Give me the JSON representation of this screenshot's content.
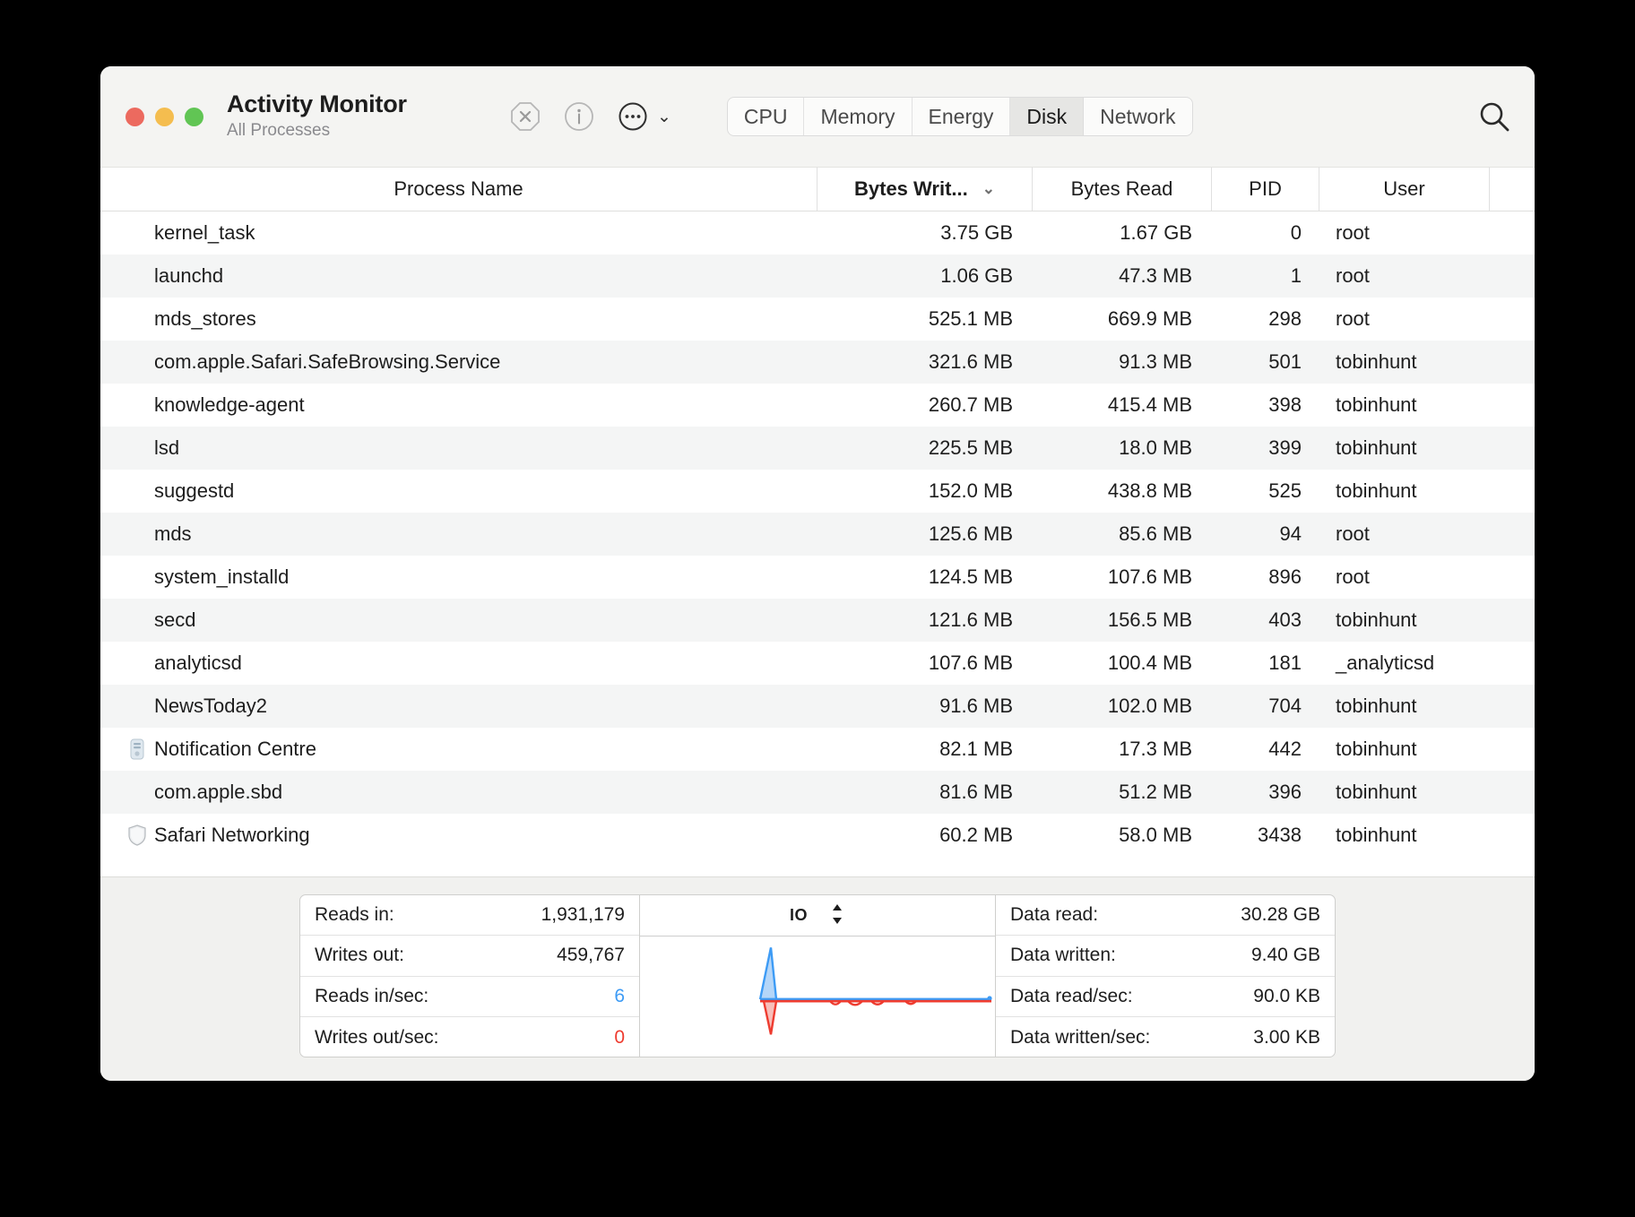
{
  "window": {
    "app_title": "Activity Monitor",
    "subtitle": "All Processes"
  },
  "toolbar": {
    "quit_icon": "stop-process-icon",
    "info_icon": "info-icon",
    "more_icon": "more-options-icon",
    "chevron": "⌄",
    "search_icon": "search-icon",
    "tabs": [
      {
        "label": "CPU",
        "active": false
      },
      {
        "label": "Memory",
        "active": false
      },
      {
        "label": "Energy",
        "active": false
      },
      {
        "label": "Disk",
        "active": true
      },
      {
        "label": "Network",
        "active": false
      }
    ]
  },
  "table": {
    "columns": [
      {
        "key": "name",
        "label": "Process Name"
      },
      {
        "key": "bytes_written",
        "label": "Bytes Writ...",
        "sorted": true,
        "sort_chevron": "⌄"
      },
      {
        "key": "bytes_read",
        "label": "Bytes Read"
      },
      {
        "key": "pid",
        "label": "PID"
      },
      {
        "key": "user",
        "label": "User"
      }
    ],
    "rows": [
      {
        "name": "kernel_task",
        "bytes_written": "3.75 GB",
        "bytes_read": "1.67 GB",
        "pid": "0",
        "user": "root",
        "icon": null
      },
      {
        "name": "launchd",
        "bytes_written": "1.06 GB",
        "bytes_read": "47.3 MB",
        "pid": "1",
        "user": "root",
        "icon": null
      },
      {
        "name": "mds_stores",
        "bytes_written": "525.1 MB",
        "bytes_read": "669.9 MB",
        "pid": "298",
        "user": "root",
        "icon": null
      },
      {
        "name": "com.apple.Safari.SafeBrowsing.Service",
        "bytes_written": "321.6 MB",
        "bytes_read": "91.3 MB",
        "pid": "501",
        "user": "tobinhunt",
        "icon": null
      },
      {
        "name": "knowledge-agent",
        "bytes_written": "260.7 MB",
        "bytes_read": "415.4 MB",
        "pid": "398",
        "user": "tobinhunt",
        "icon": null
      },
      {
        "name": "lsd",
        "bytes_written": "225.5 MB",
        "bytes_read": "18.0 MB",
        "pid": "399",
        "user": "tobinhunt",
        "icon": null
      },
      {
        "name": "suggestd",
        "bytes_written": "152.0 MB",
        "bytes_read": "438.8 MB",
        "pid": "525",
        "user": "tobinhunt",
        "icon": null
      },
      {
        "name": "mds",
        "bytes_written": "125.6 MB",
        "bytes_read": "85.6 MB",
        "pid": "94",
        "user": "root",
        "icon": null
      },
      {
        "name": "system_installd",
        "bytes_written": "124.5 MB",
        "bytes_read": "107.6 MB",
        "pid": "896",
        "user": "root",
        "icon": null
      },
      {
        "name": "secd",
        "bytes_written": "121.6 MB",
        "bytes_read": "156.5 MB",
        "pid": "403",
        "user": "tobinhunt",
        "icon": null
      },
      {
        "name": "analyticsd",
        "bytes_written": "107.6 MB",
        "bytes_read": "100.4 MB",
        "pid": "181",
        "user": "_analyticsd",
        "icon": null
      },
      {
        "name": "NewsToday2",
        "bytes_written": "91.6 MB",
        "bytes_read": "102.0 MB",
        "pid": "704",
        "user": "tobinhunt",
        "icon": null
      },
      {
        "name": "Notification Centre",
        "bytes_written": "82.1 MB",
        "bytes_read": "17.3 MB",
        "pid": "442",
        "user": "tobinhunt",
        "icon": "notification-centre-app-icon"
      },
      {
        "name": "com.apple.sbd",
        "bytes_written": "81.6 MB",
        "bytes_read": "51.2 MB",
        "pid": "396",
        "user": "tobinhunt",
        "icon": null
      },
      {
        "name": "Safari Networking",
        "bytes_written": "60.2 MB",
        "bytes_read": "58.0 MB",
        "pid": "3438",
        "user": "tobinhunt",
        "icon": "safari-shield-app-icon"
      }
    ]
  },
  "bottom": {
    "left_stats": [
      {
        "label": "Reads in:",
        "value": "1,931,179",
        "color": "default"
      },
      {
        "label": "Writes out:",
        "value": "459,767",
        "color": "default"
      },
      {
        "label": "Reads in/sec:",
        "value": "6",
        "color": "blue"
      },
      {
        "label": "Writes out/sec:",
        "value": "0",
        "color": "red"
      }
    ],
    "graph": {
      "title": "IO",
      "stepper_icon": "up-down-stepper-icon",
      "read_color": "#3d9bf5",
      "write_color": "#ee3b2f"
    },
    "right_stats": [
      {
        "label": "Data read:",
        "value": "30.28 GB"
      },
      {
        "label": "Data written:",
        "value": "9.40 GB"
      },
      {
        "label": "Data read/sec:",
        "value": "90.0 KB"
      },
      {
        "label": "Data written/sec:",
        "value": "3.00 KB"
      }
    ]
  },
  "colors": {
    "accent_blue": "#3d9bf5",
    "accent_red": "#ee3b2f",
    "traffic_red": "#ec6a5f",
    "traffic_yellow": "#f4bd4f",
    "traffic_green": "#61c554"
  }
}
